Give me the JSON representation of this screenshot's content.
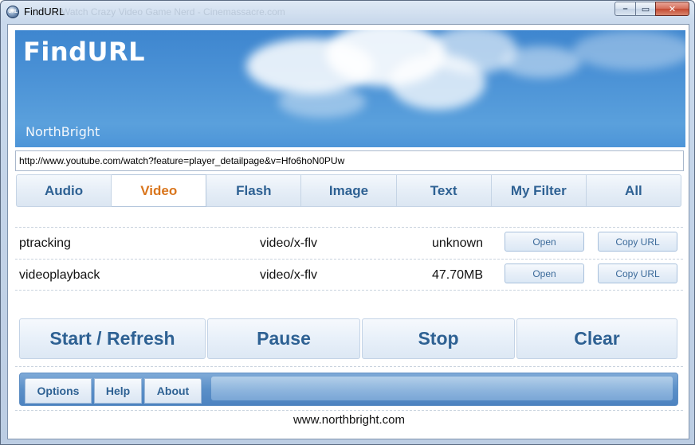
{
  "window": {
    "title": "FindURL",
    "icon_text": "URL",
    "ghost_title": "Watch Crazy Video Game Nerd - Cinemassacre.com",
    "caption_buttons": {
      "minimize": "–",
      "maximize": "▭",
      "close": "✕"
    }
  },
  "banner": {
    "title": "FindURL",
    "subtitle": "NorthBright"
  },
  "url": {
    "value": "http://www.youtube.com/watch?feature=player_detailpage&v=Hfo6hoN0PUw"
  },
  "tabs": [
    {
      "label": "Audio",
      "active": false
    },
    {
      "label": "Video",
      "active": true
    },
    {
      "label": "Flash",
      "active": false
    },
    {
      "label": "Image",
      "active": false
    },
    {
      "label": "Text",
      "active": false
    },
    {
      "label": "My Filter",
      "active": false
    },
    {
      "label": "All",
      "active": false
    }
  ],
  "results": [
    {
      "name": "ptracking",
      "type": "video/x-flv",
      "size": "unknown",
      "open_label": "Open",
      "copy_label": "Copy URL"
    },
    {
      "name": "videoplayback",
      "type": "video/x-flv",
      "size": "47.70MB",
      "open_label": "Open",
      "copy_label": "Copy URL"
    }
  ],
  "actions": {
    "start": "Start / Refresh",
    "pause": "Pause",
    "stop": "Stop",
    "clear": "Clear"
  },
  "menu": {
    "options": "Options",
    "help": "Help",
    "about": "About"
  },
  "footer": {
    "link": "www.northbright.com"
  },
  "colors": {
    "accent_text": "#2e6193",
    "active_tab": "#d9751c",
    "banner_blue": "#4b92d6"
  }
}
